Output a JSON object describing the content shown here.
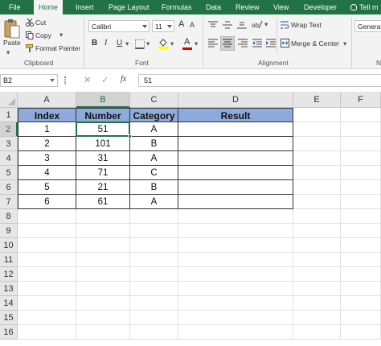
{
  "ribbon_tabs": [
    "File",
    "Home",
    "Insert",
    "Page Layout",
    "Formulas",
    "Data",
    "Review",
    "View",
    "Developer",
    "Tell m"
  ],
  "active_tab": "Home",
  "clipboard": {
    "paste_label": "Paste",
    "cut_label": "Cut",
    "copy_label": "Copy",
    "format_painter_label": "Format Painter",
    "group_label": "Clipboard"
  },
  "font": {
    "font_name": "Calibri",
    "font_size": "11",
    "bold": "B",
    "italic": "I",
    "underline": "U",
    "grow": "A",
    "shrink": "A",
    "group_label": "Font",
    "fill_color": "#ffff00",
    "font_color": "#e00000"
  },
  "alignment": {
    "wrap_text_label": "Wrap Text",
    "merge_center_label": "Merge & Center",
    "group_label": "Alignment"
  },
  "number": {
    "format": "General",
    "group_label_partial": "N"
  },
  "formula_bar": {
    "name_box": "B2",
    "cancel": "✕",
    "enter": "✓",
    "fx": "fx",
    "content": "51"
  },
  "sheet": {
    "columns": [
      "A",
      "B",
      "C",
      "D",
      "E",
      "F"
    ],
    "rows": [
      "1",
      "2",
      "3",
      "4",
      "5",
      "6",
      "7",
      "8",
      "9",
      "10",
      "11",
      "12",
      "13",
      "14",
      "15",
      "16"
    ],
    "headers": [
      "Index",
      "Number",
      "Category",
      "Result"
    ],
    "data": [
      [
        "1",
        "51",
        "A",
        ""
      ],
      [
        "2",
        "101",
        "B",
        ""
      ],
      [
        "3",
        "31",
        "A",
        ""
      ],
      [
        "4",
        "71",
        "C",
        ""
      ],
      [
        "5",
        "21",
        "B",
        ""
      ],
      [
        "6",
        "61",
        "A",
        ""
      ]
    ],
    "selected_cell": "B2",
    "header_fill": "#8eaadb"
  },
  "colors": {
    "excel_green": "#217346"
  }
}
